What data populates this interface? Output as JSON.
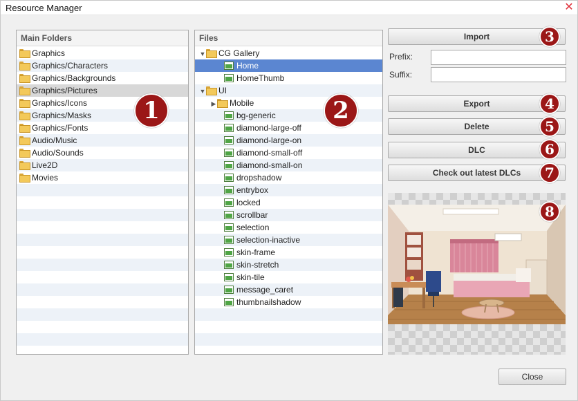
{
  "window": {
    "title": "Resource Manager",
    "close_glyph": "✕"
  },
  "folders_panel": {
    "header": "Main Folders",
    "items": [
      "Graphics",
      "Graphics/Characters",
      "Graphics/Backgrounds",
      "Graphics/Pictures",
      "Graphics/Icons",
      "Graphics/Masks",
      "Graphics/Fonts",
      "Audio/Music",
      "Audio/Sounds",
      "Live2D",
      "Movies"
    ],
    "selected": "Graphics/Pictures"
  },
  "files_panel": {
    "header": "Files",
    "tree": [
      {
        "label": "CG Gallery",
        "kind": "folder",
        "depth": 0,
        "expander": "▼"
      },
      {
        "label": "Home",
        "kind": "image",
        "depth": 1,
        "selected": true
      },
      {
        "label": "HomeThumb",
        "kind": "image",
        "depth": 1
      },
      {
        "label": "UI",
        "kind": "folder",
        "depth": 0,
        "expander": "▼"
      },
      {
        "label": "Mobile",
        "kind": "folder",
        "depth": 1,
        "expander": "▶"
      },
      {
        "label": "bg-generic",
        "kind": "image",
        "depth": 1
      },
      {
        "label": "diamond-large-off",
        "kind": "image",
        "depth": 1
      },
      {
        "label": "diamond-large-on",
        "kind": "image",
        "depth": 1
      },
      {
        "label": "diamond-small-off",
        "kind": "image",
        "depth": 1
      },
      {
        "label": "diamond-small-on",
        "kind": "image",
        "depth": 1
      },
      {
        "label": "dropshadow",
        "kind": "image",
        "depth": 1
      },
      {
        "label": "entrybox",
        "kind": "image",
        "depth": 1
      },
      {
        "label": "locked",
        "kind": "image",
        "depth": 1
      },
      {
        "label": "scrollbar",
        "kind": "image",
        "depth": 1
      },
      {
        "label": "selection",
        "kind": "image",
        "depth": 1
      },
      {
        "label": "selection-inactive",
        "kind": "image",
        "depth": 1
      },
      {
        "label": "skin-frame",
        "kind": "image",
        "depth": 1
      },
      {
        "label": "skin-stretch",
        "kind": "image",
        "depth": 1
      },
      {
        "label": "skin-tile",
        "kind": "image",
        "depth": 1
      },
      {
        "label": "message_caret",
        "kind": "image",
        "depth": 1
      },
      {
        "label": "thumbnailshadow",
        "kind": "image",
        "depth": 1
      }
    ]
  },
  "actions": {
    "import_label": "Import",
    "prefix_label": "Prefix:",
    "prefix_value": "",
    "suffix_label": "Suffix:",
    "suffix_value": "",
    "export_label": "Export",
    "delete_label": "Delete",
    "dlc_label": "DLC",
    "check_dlcs_label": "Check out latest DLCs",
    "close_label": "Close"
  },
  "badges": [
    "1",
    "2",
    "3",
    "4",
    "5",
    "6",
    "7",
    "8"
  ],
  "colors": {
    "badge": "#9b1717",
    "selection_blue": "#5b86d1",
    "selection_grey": "#d8d8d8",
    "close_red": "#e0303a"
  }
}
